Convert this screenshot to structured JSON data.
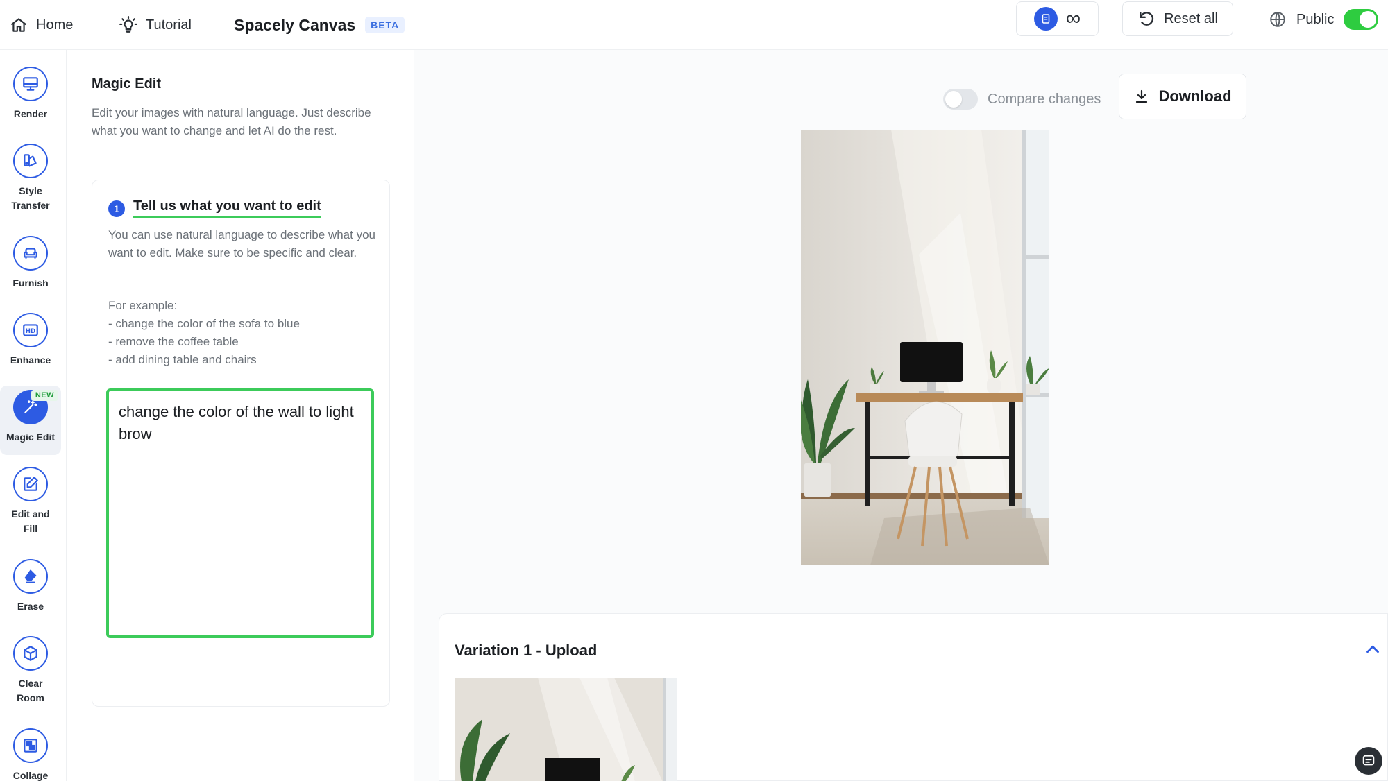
{
  "topbar": {
    "home": "Home",
    "tutorial": "Tutorial",
    "app_name": "Spacely Canvas",
    "beta": "BETA",
    "credits": "∞",
    "reset_all": "Reset all",
    "public": "Public",
    "public_enabled": true
  },
  "tools": [
    {
      "label": "Render",
      "icon": "monitor-icon"
    },
    {
      "label": "Style Transfer",
      "icon": "palette-icon"
    },
    {
      "label": "Furnish",
      "icon": "sofa-icon"
    },
    {
      "label": "Enhance",
      "icon": "hd-icon"
    },
    {
      "label": "Magic Edit",
      "icon": "magic-wand-icon",
      "badge": "NEW",
      "active": true
    },
    {
      "label": "Edit and Fill",
      "icon": "pencil-edit-icon"
    },
    {
      "label": "Erase",
      "icon": "eraser-icon"
    },
    {
      "label": "Clear Room",
      "icon": "cube-icon"
    },
    {
      "label": "Collage",
      "icon": "collage-icon"
    }
  ],
  "panel": {
    "title": "Magic Edit",
    "description": "Edit your images with natural language. Just describe what you want to change and let AI do the rest.",
    "step": {
      "number": "1",
      "title": "Tell us what you want to edit",
      "text": "You can use natural language to describe what you want to edit. Make sure to be specific and clear.",
      "examples_heading": "For example:",
      "examples": [
        "- change the color of the sofa to blue",
        "- remove the coffee table",
        "- add dining table and chairs"
      ]
    },
    "prompt_value": "change the color of the wall to light brow"
  },
  "main": {
    "compare_label": "Compare changes",
    "compare_enabled": false,
    "download": "Download",
    "variation_title": "Variation 1 - Upload"
  },
  "colors": {
    "accent": "#2d5be3",
    "green": "#3ccb5a"
  }
}
